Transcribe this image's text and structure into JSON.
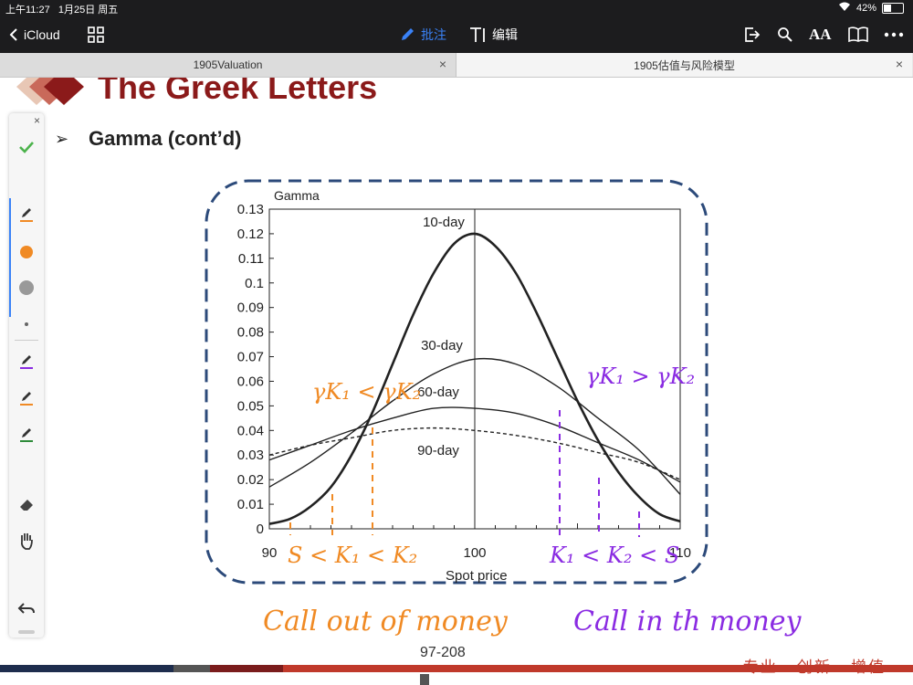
{
  "status": {
    "time": "上午11:27",
    "date": "1月25日 周五",
    "battery": "42%"
  },
  "toolbar": {
    "back_label": "iCloud",
    "annotate_label": "批注",
    "edit_label": "编辑",
    "text_size_label": "AA"
  },
  "tabs": [
    {
      "label": "1905Valuation",
      "close": "×"
    },
    {
      "label": "1905估值与风险模型",
      "close": "×"
    }
  ],
  "palette": {
    "close": "×"
  },
  "slide": {
    "title": "The Greek Letters",
    "subtitle_bullet": "➢",
    "subtitle": "Gamma (cont’d)",
    "page_number": "97-208",
    "brand": "专业 · 创新 · 增值"
  },
  "colors": {
    "title": "#8b1a1a",
    "orange": "#f08a24",
    "purple": "#8a2be2",
    "navy": "#2c4a7a",
    "footer_red": "#c0392b"
  },
  "annotations": {
    "orange_ineq": "γK₁ < γK₂",
    "orange_order": "S < K₁ < K₂",
    "orange_note": "Call out of money",
    "purple_ineq": "γK₁ > γK₂",
    "purple_order": "K₁ < K₂ < S",
    "purple_note": "Call in th money"
  },
  "chart_data": {
    "type": "line",
    "title": "Gamma",
    "xlabel": "Spot price",
    "ylabel": "",
    "xlim": [
      90,
      110
    ],
    "ylim": [
      0,
      0.13
    ],
    "x_ticks": [
      90,
      100,
      110
    ],
    "y_ticks": [
      0,
      0.01,
      0.02,
      0.03,
      0.04,
      0.05,
      0.06,
      0.07,
      0.08,
      0.09,
      0.1,
      0.11,
      0.12,
      0.13
    ],
    "vertical_line_at": 100,
    "series": [
      {
        "name": "10-day",
        "x": [
          90,
          91,
          92,
          93,
          94,
          95,
          96,
          97,
          98,
          99,
          100,
          101,
          102,
          103,
          104,
          105,
          106,
          107,
          108,
          109,
          110
        ],
        "y": [
          0.002,
          0.004,
          0.009,
          0.017,
          0.03,
          0.047,
          0.067,
          0.087,
          0.104,
          0.116,
          0.12,
          0.115,
          0.104,
          0.088,
          0.07,
          0.052,
          0.036,
          0.023,
          0.013,
          0.006,
          0.003
        ]
      },
      {
        "name": "30-day",
        "x": [
          90,
          92,
          94,
          96,
          98,
          100,
          102,
          104,
          106,
          108,
          110
        ],
        "y": [
          0.017,
          0.027,
          0.039,
          0.052,
          0.063,
          0.069,
          0.067,
          0.058,
          0.045,
          0.032,
          0.014
        ]
      },
      {
        "name": "60-day",
        "x": [
          90,
          92,
          94,
          96,
          98,
          100,
          102,
          104,
          106,
          108,
          110
        ],
        "y": [
          0.028,
          0.034,
          0.04,
          0.045,
          0.049,
          0.049,
          0.047,
          0.042,
          0.035,
          0.028,
          0.019
        ]
      },
      {
        "name": "90-day",
        "x": [
          90,
          92,
          94,
          96,
          98,
          100,
          102,
          104,
          106,
          108,
          110
        ],
        "y": [
          0.03,
          0.034,
          0.037,
          0.04,
          0.041,
          0.04,
          0.038,
          0.035,
          0.031,
          0.027,
          0.02
        ],
        "dashed": true
      }
    ]
  }
}
